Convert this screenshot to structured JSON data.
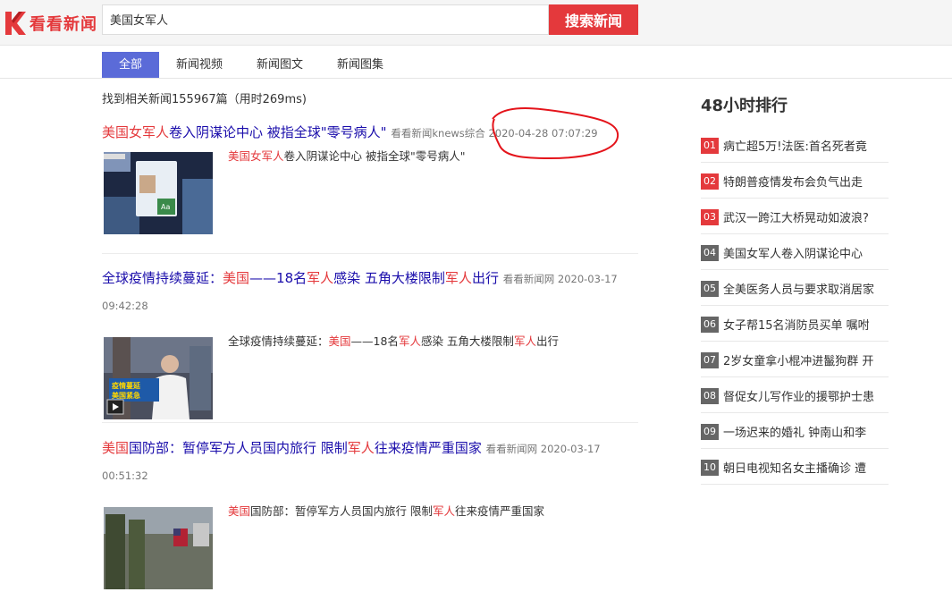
{
  "header": {
    "logo_text": "看看新闻",
    "search_value": "美国女军人",
    "search_button": "搜索新闻"
  },
  "tabs": [
    {
      "label": "全部",
      "active": true
    },
    {
      "label": "新闻视频",
      "active": false
    },
    {
      "label": "新闻图文",
      "active": false
    },
    {
      "label": "新闻图集",
      "active": false
    }
  ],
  "result_count": "找到相关新闻155967篇（用时269ms)",
  "results": [
    {
      "title_parts": [
        {
          "text": "美国女军人",
          "hl": true
        },
        {
          "text": "卷入阴谋论中心 被指全球\"零号病人\"",
          "hl": false
        }
      ],
      "meta": "看看新闻knews综合 2020-04-28 07:07:29",
      "summary_parts": [
        {
          "text": "美国女军人",
          "hl": true
        },
        {
          "text": "卷入阴谋论中心 被指全球\"零号病人\"",
          "hl": false
        }
      ]
    },
    {
      "title_parts": [
        {
          "text": "全球疫情持续蔓延：",
          "hl": false
        },
        {
          "text": "美国",
          "hl": true
        },
        {
          "text": "——18名",
          "hl": false
        },
        {
          "text": "军人",
          "hl": true
        },
        {
          "text": "感染 五角大楼限制",
          "hl": false
        },
        {
          "text": "军人",
          "hl": true
        },
        {
          "text": "出行",
          "hl": false
        }
      ],
      "meta": "看看新闻网 2020-03-17 09:42:28",
      "summary_parts": [
        {
          "text": "全球疫情持续蔓延：",
          "hl": false
        },
        {
          "text": "美国",
          "hl": true
        },
        {
          "text": "——18名",
          "hl": false
        },
        {
          "text": "军人",
          "hl": true
        },
        {
          "text": "感染 五角大楼限制",
          "hl": false
        },
        {
          "text": "军人",
          "hl": true
        },
        {
          "text": "出行",
          "hl": false
        }
      ],
      "thumb_caption_1": "疫情蔓延",
      "thumb_caption_2": "美国紧急"
    },
    {
      "title_parts": [
        {
          "text": "美国",
          "hl": true
        },
        {
          "text": "国防部：暂停军方人员国内旅行 限制",
          "hl": false
        },
        {
          "text": "军人",
          "hl": true
        },
        {
          "text": "往来疫情严重国家",
          "hl": false
        }
      ],
      "meta": "看看新闻网 2020-03-17 00:51:32",
      "summary_parts": [
        {
          "text": "美国",
          "hl": true
        },
        {
          "text": "国防部：暂停军方人员国内旅行 限制",
          "hl": false
        },
        {
          "text": "军人",
          "hl": true
        },
        {
          "text": "往来疫情严重国家",
          "hl": false
        }
      ]
    }
  ],
  "sidebar": {
    "title": "48小时排行",
    "items": [
      {
        "rank": "01",
        "text": "病亡超5万!法医:首名死者竟"
      },
      {
        "rank": "02",
        "text": "特朗普疫情发布会负气出走"
      },
      {
        "rank": "03",
        "text": "武汉一跨江大桥晃动如波浪?"
      },
      {
        "rank": "04",
        "text": "美国女军人卷入阴谋论中心"
      },
      {
        "rank": "05",
        "text": "全美医务人员与要求取消居家"
      },
      {
        "rank": "06",
        "text": "女子帮15名消防员买单 嘱咐"
      },
      {
        "rank": "07",
        "text": "2岁女童拿小棍冲进鬣狗群 开"
      },
      {
        "rank": "08",
        "text": "督促女儿写作业的援鄂护士患"
      },
      {
        "rank": "09",
        "text": "一场迟来的婚礼 钟南山和李"
      },
      {
        "rank": "10",
        "text": "朝日电视知名女主播确诊 遭"
      }
    ]
  },
  "colors": {
    "brand_red": "#e4393c",
    "tab_active": "#5b6bd8",
    "title_blue": "#1a0dab",
    "rank_gray": "#666666"
  }
}
